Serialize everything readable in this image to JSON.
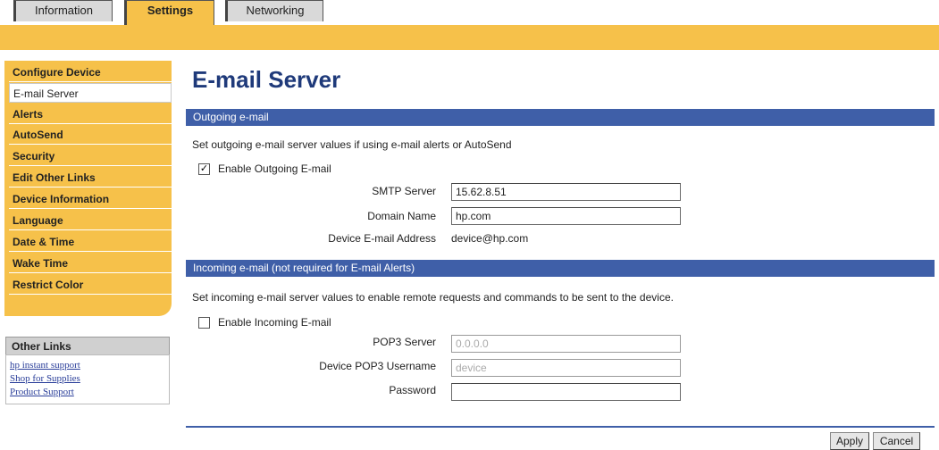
{
  "tabs": [
    {
      "label": "Information"
    },
    {
      "label": "Settings"
    },
    {
      "label": "Networking"
    }
  ],
  "sidebar": {
    "items": [
      {
        "label": "Configure Device"
      },
      {
        "label": "E-mail Server"
      },
      {
        "label": "Alerts"
      },
      {
        "label": "AutoSend"
      },
      {
        "label": "Security"
      },
      {
        "label": "Edit Other Links"
      },
      {
        "label": "Device Information"
      },
      {
        "label": "Language"
      },
      {
        "label": "Date & Time"
      },
      {
        "label": "Wake Time"
      },
      {
        "label": "Restrict Color"
      }
    ],
    "selected": "E-mail Server"
  },
  "other_links": {
    "header": "Other Links",
    "links": [
      "hp instant support",
      "Shop for Supplies",
      "Product Support"
    ]
  },
  "page": {
    "title": "E-mail Server"
  },
  "outgoing": {
    "header": "Outgoing e-mail",
    "description": "Set outgoing e-mail server values if using e-mail alerts or AutoSend",
    "enable_label": "Enable Outgoing E-mail",
    "enabled": true,
    "smtp_label": "SMTP Server",
    "smtp_value": "15.62.8.51",
    "domain_label": "Domain Name",
    "domain_value": "hp.com",
    "address_label": "Device E-mail Address",
    "address_value": "device@hp.com"
  },
  "incoming": {
    "header": "Incoming e-mail (not required for E-mail Alerts)",
    "description": "Set incoming e-mail server values to enable remote requests and commands to be sent to the device.",
    "enable_label": "Enable Incoming E-mail",
    "enabled": false,
    "pop3_label": "POP3 Server",
    "pop3_value": "0.0.0.0",
    "username_label": "Device POP3 Username",
    "username_value": "device",
    "password_label": "Password",
    "password_value": ""
  },
  "buttons": {
    "apply": "Apply",
    "cancel": "Cancel"
  },
  "colors": {
    "accent_orange": "#f6c14a",
    "bar_blue": "#3f5fa8",
    "title_blue": "#1f3a7a"
  }
}
